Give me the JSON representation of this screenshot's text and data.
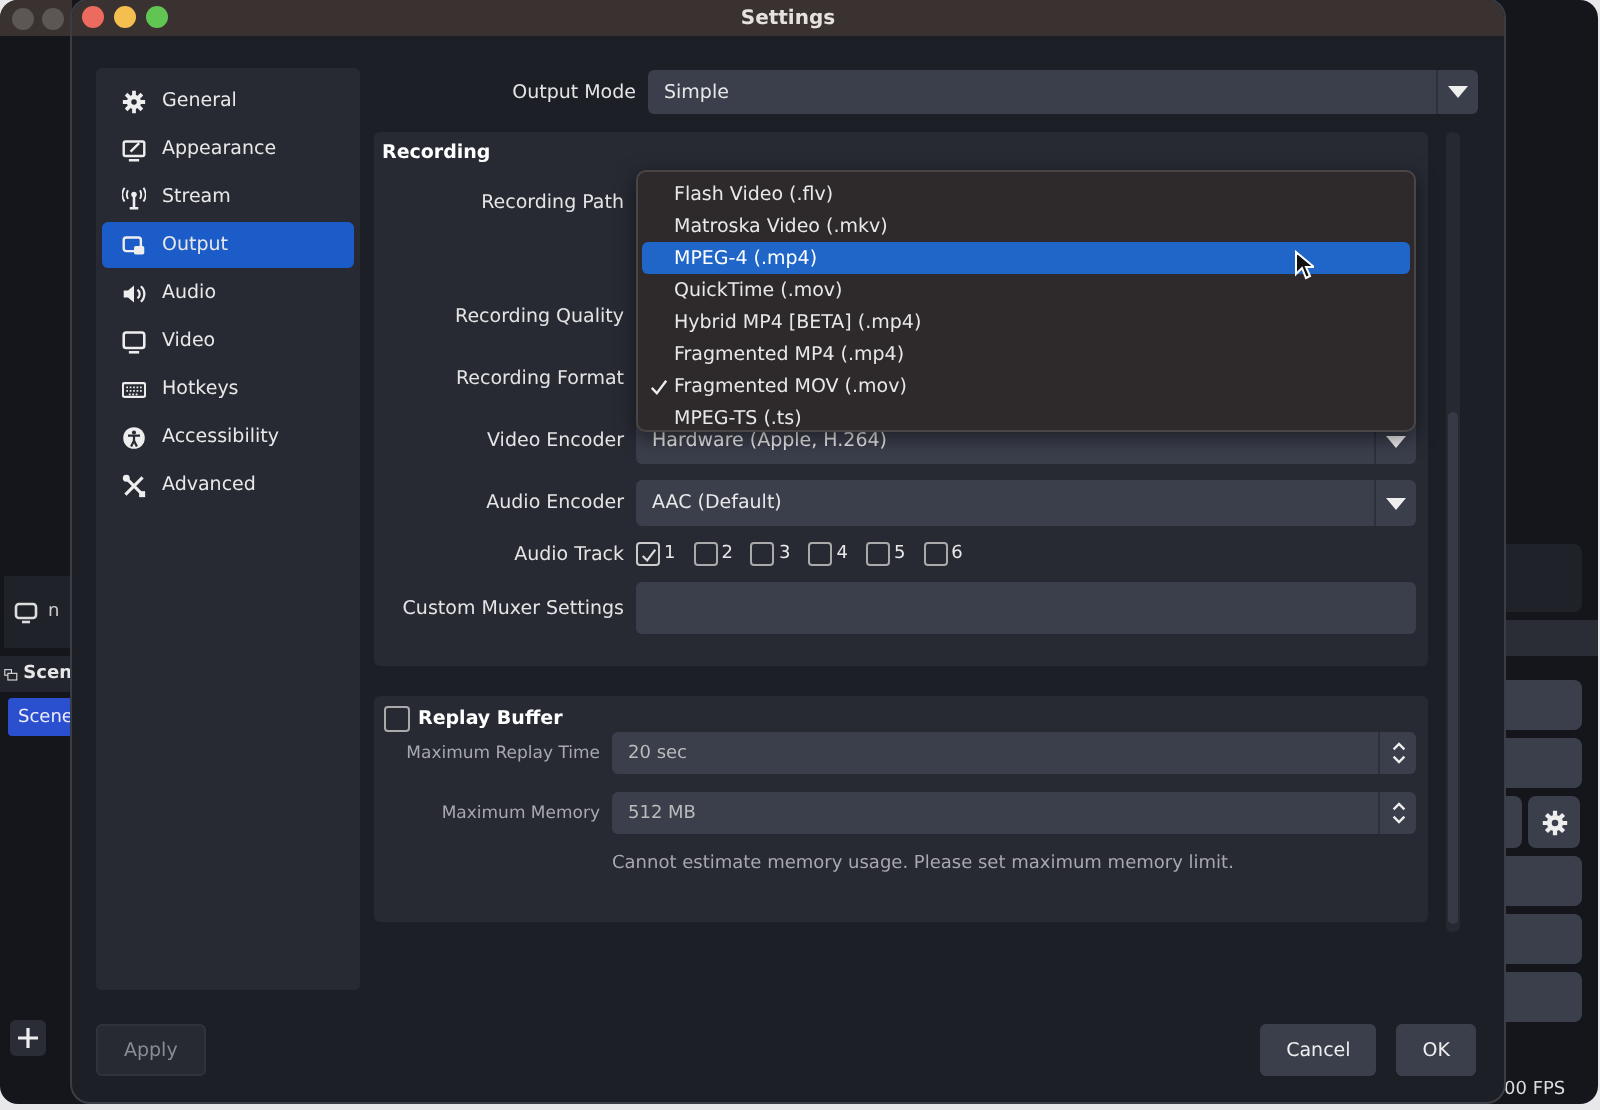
{
  "background_window": {
    "source_label": "n",
    "scenes_header": "Scen",
    "scenes": [
      {
        "label": "Scene",
        "selected": true
      }
    ],
    "status_fps": "00 FPS"
  },
  "window": {
    "title": "Settings"
  },
  "sidebar": {
    "items": [
      {
        "label": "General",
        "selected": false
      },
      {
        "label": "Appearance",
        "selected": false
      },
      {
        "label": "Stream",
        "selected": false
      },
      {
        "label": "Output",
        "selected": true
      },
      {
        "label": "Audio",
        "selected": false
      },
      {
        "label": "Video",
        "selected": false
      },
      {
        "label": "Hotkeys",
        "selected": false
      },
      {
        "label": "Accessibility",
        "selected": false
      },
      {
        "label": "Advanced",
        "selected": false
      }
    ]
  },
  "output_mode": {
    "label": "Output Mode",
    "value": "Simple"
  },
  "recording": {
    "title": "Recording",
    "rows": [
      {
        "kind": "path",
        "label": "Recording Path"
      },
      {
        "kind": "combo",
        "label": "Recording Quality"
      },
      {
        "kind": "combo",
        "label": "Recording Format"
      },
      {
        "kind": "combo",
        "label": "Video Encoder",
        "value": "Hardware (Apple, H.264)"
      },
      {
        "kind": "combo",
        "label": "Audio Encoder",
        "value": "AAC (Default)"
      },
      {
        "kind": "tracks",
        "label": "Audio Track",
        "tracks": [
          {
            "label": "1",
            "checked": true
          },
          {
            "label": "2",
            "checked": false
          },
          {
            "label": "3",
            "checked": false
          },
          {
            "label": "4",
            "checked": false
          },
          {
            "label": "5",
            "checked": false
          },
          {
            "label": "6",
            "checked": false
          }
        ]
      },
      {
        "kind": "text",
        "label": "Custom Muxer Settings"
      }
    ]
  },
  "format_dropdown": {
    "options": [
      {
        "label": "Flash Video (.flv)",
        "selected": false,
        "checked": false
      },
      {
        "label": "Matroska Video (.mkv)",
        "selected": false,
        "checked": false
      },
      {
        "label": "MPEG-4 (.mp4)",
        "selected": true,
        "checked": false
      },
      {
        "label": "QuickTime (.mov)",
        "selected": false,
        "checked": false
      },
      {
        "label": "Hybrid MP4 [BETA] (.mp4)",
        "selected": false,
        "checked": false
      },
      {
        "label": "Fragmented MP4 (.mp4)",
        "selected": false,
        "checked": false
      },
      {
        "label": "Fragmented MOV (.mov)",
        "selected": false,
        "checked": true
      },
      {
        "label": "MPEG-TS (.ts)",
        "selected": false,
        "checked": false
      }
    ]
  },
  "replay_buffer": {
    "label": "Replay Buffer",
    "checked": false,
    "rows": [
      {
        "label": "Maximum Replay Time",
        "value": "20 sec"
      },
      {
        "label": "Maximum Memory",
        "value": "512 MB"
      }
    ],
    "note": "Cannot estimate memory usage. Please set maximum memory limit."
  },
  "buttons": [
    {
      "kind": "apply",
      "label": "Apply",
      "disabled": true
    },
    {
      "kind": "cancel",
      "label": "Cancel",
      "disabled": false
    },
    {
      "kind": "ok",
      "label": "OK",
      "disabled": false
    }
  ]
}
